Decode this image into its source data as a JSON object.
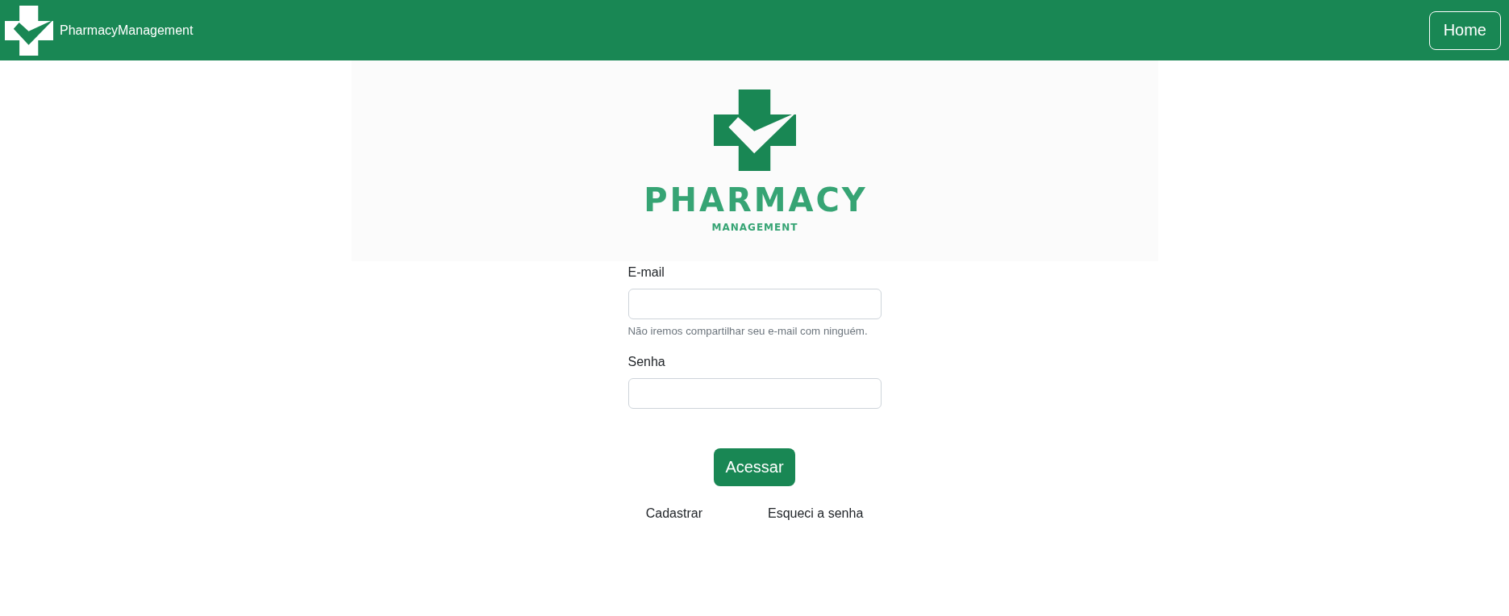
{
  "navbar": {
    "brand": "PharmacyManagement",
    "home_button": "Home"
  },
  "banner": {
    "title": "PHARMACY",
    "subtitle": "MANAGEMENT"
  },
  "form": {
    "fields": [
      {
        "label": "E-mail",
        "help": "Não iremos compartilhar seu e-mail com ninguém."
      },
      {
        "label": "Senha"
      }
    ],
    "submit": "Acessar",
    "links": [
      "Cadastrar",
      "Esqueci a senha"
    ]
  }
}
